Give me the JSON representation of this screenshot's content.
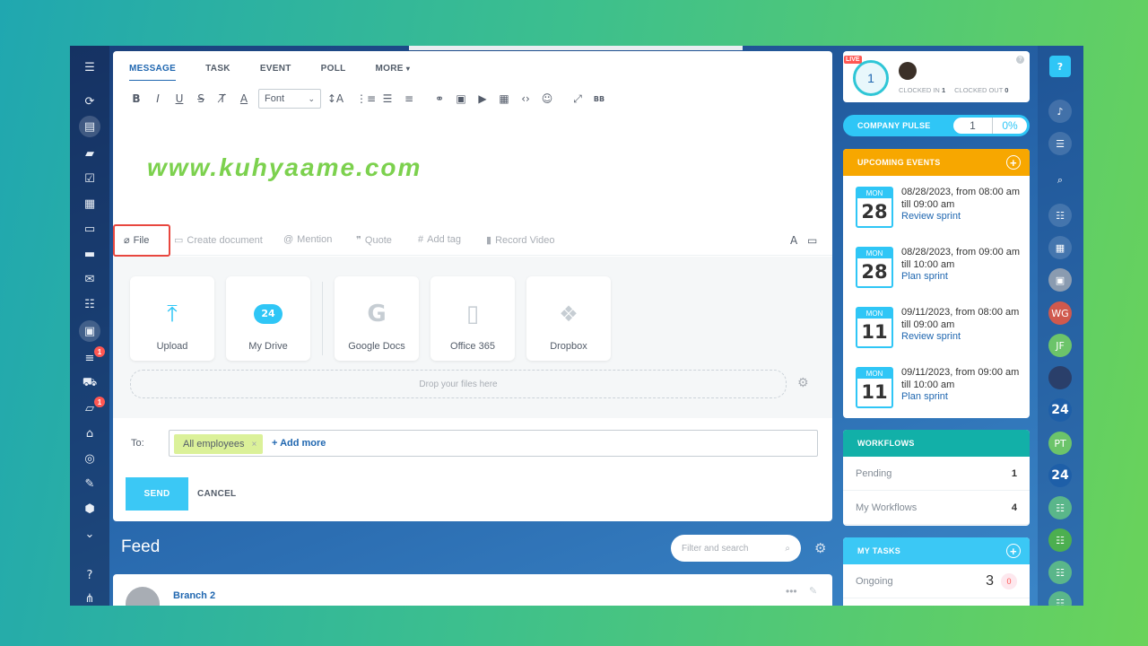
{
  "composer": {
    "tabs": [
      "MESSAGE",
      "TASK",
      "EVENT",
      "POLL",
      "MORE"
    ],
    "more_caret": "▾",
    "font_label": "Font",
    "watermark": "www.kuhyaame.com",
    "actions": {
      "file": "File",
      "create_document": "Create document",
      "mention": "Mention",
      "quote": "Quote",
      "add_tag": "Add tag",
      "record_video": "Record Video"
    },
    "upload_tiles": [
      {
        "label": "Upload",
        "icon": "upload-icon"
      },
      {
        "label": "My Drive",
        "icon": "my-drive-icon"
      },
      {
        "label": "Google Docs",
        "icon": "google-docs-icon"
      },
      {
        "label": "Office 365",
        "icon": "office-365-icon"
      },
      {
        "label": "Dropbox",
        "icon": "dropbox-icon"
      }
    ],
    "drive_badge": "24",
    "dropzone_text": "Drop your files here",
    "to_label": "To:",
    "recipient": "All employees",
    "add_more": "+ Add more",
    "send_label": "SEND",
    "cancel_label": "CANCEL"
  },
  "feed": {
    "title": "Feed",
    "search_placeholder": "Filter and search",
    "post_author": "Branch 2",
    "post_more": "•••"
  },
  "clock": {
    "live": "LIVE",
    "value": "1",
    "clocked_in_label": "CLOCKED IN",
    "clocked_in": "1",
    "clocked_out_label": "CLOCKED OUT",
    "clocked_out": "0",
    "help": "?"
  },
  "pulse": {
    "label": "COMPANY PULSE",
    "value": "1",
    "percent": "0%"
  },
  "events": {
    "title": "UPCOMING EVENTS",
    "items": [
      {
        "day": "MON",
        "date": "28",
        "text": "08/28/2023, from 08:00 am till 09:00 am",
        "link": "Review sprint"
      },
      {
        "day": "MON",
        "date": "28",
        "text": "08/28/2023, from 09:00 am till 10:00 am",
        "link": "Plan sprint"
      },
      {
        "day": "MON",
        "date": "11",
        "text": "09/11/2023, from 08:00 am till 09:00 am",
        "link": "Review sprint"
      },
      {
        "day": "MON",
        "date": "11",
        "text": "09/11/2023, from 09:00 am till 10:00 am",
        "link": "Plan sprint"
      }
    ]
  },
  "workflows": {
    "title": "WORKFLOWS",
    "rows": [
      {
        "label": "Pending",
        "count": "1"
      },
      {
        "label": "My Workflows",
        "count": "4"
      }
    ]
  },
  "tasks": {
    "title": "MY TASKS",
    "rows": [
      {
        "label": "Ongoing",
        "count": "3",
        "overdue": "0"
      }
    ]
  },
  "leftnav_badges": [
    "1",
    "1"
  ],
  "rail": {
    "help": "?",
    "avatars": [
      "WG",
      "JF",
      "PT"
    ],
    "brand": "24"
  },
  "colors": {
    "accent": "#2fc6f6",
    "events": "#f7a700",
    "workflows": "#12b0a8",
    "highlight": "#e8473f"
  }
}
